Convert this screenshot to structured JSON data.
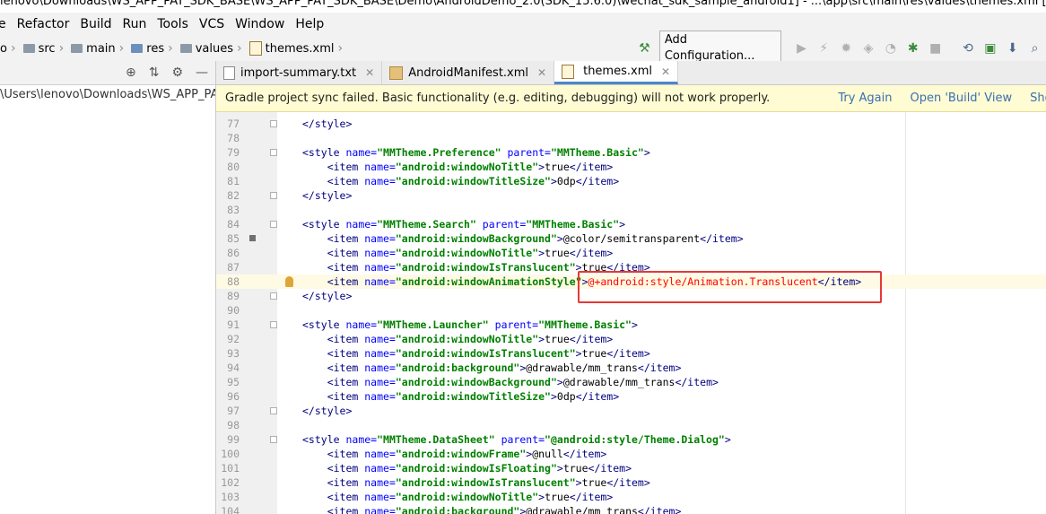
{
  "window": {
    "title": "lenovo\\Downloads\\WS_APP_PAY_SDK_BASE\\WS_APP_PAY_SDK_BASE\\Demo\\AndroidDemo_2.0(SDK_15.6.0)\\wechat_sdk_sample_android1] - ...\\app\\src\\main\\res\\values\\themes.xml [app] -..."
  },
  "menu": {
    "items": [
      "e",
      "Refactor",
      "Build",
      "Run",
      "Tools",
      "VCS",
      "Window",
      "Help"
    ]
  },
  "breadcrumb": {
    "items": [
      "o",
      "src",
      "main",
      "res",
      "values",
      "themes.xml"
    ]
  },
  "toolbar": {
    "add_configuration": "Add Configuration..."
  },
  "sidebar": {
    "path": "\\Users\\lenovo\\Downloads\\WS_APP_PAY_S"
  },
  "tabs": [
    {
      "label": "import-summary.txt",
      "active": false
    },
    {
      "label": "AndroidManifest.xml",
      "active": false
    },
    {
      "label": "themes.xml",
      "active": true
    }
  ],
  "banner": {
    "message": "Gradle project sync failed. Basic functionality (e.g. editing, debugging) will not work properly.",
    "try_again": "Try Again",
    "open_build_view": "Open 'Build' View",
    "show_log": "Show Log in Expl"
  },
  "editor": {
    "lines": [
      {
        "n": "77",
        "code": [
          {
            "t": "tag",
            "s": "</style>"
          }
        ]
      },
      {
        "n": "78",
        "code": []
      },
      {
        "n": "79",
        "code": [
          {
            "t": "tag",
            "s": "<style "
          },
          {
            "t": "attr",
            "s": "name="
          },
          {
            "t": "val",
            "s": "\"MMTheme.Preference\""
          },
          {
            "t": "attr",
            "s": " parent="
          },
          {
            "t": "val",
            "s": "\"MMTheme.Basic\""
          },
          {
            "t": "tag",
            "s": ">"
          }
        ]
      },
      {
        "n": "80",
        "code": [
          {
            "t": "plain",
            "s": "    "
          },
          {
            "t": "tag",
            "s": "<item "
          },
          {
            "t": "attr",
            "s": "name="
          },
          {
            "t": "val",
            "s": "\"android:windowNoTitle\""
          },
          {
            "t": "tag",
            "s": ">"
          },
          {
            "t": "plain",
            "s": "true"
          },
          {
            "t": "tag",
            "s": "</item>"
          }
        ]
      },
      {
        "n": "81",
        "code": [
          {
            "t": "plain",
            "s": "    "
          },
          {
            "t": "tag",
            "s": "<item "
          },
          {
            "t": "attr",
            "s": "name="
          },
          {
            "t": "val",
            "s": "\"android:windowTitleSize\""
          },
          {
            "t": "tag",
            "s": ">"
          },
          {
            "t": "plain",
            "s": "0dp"
          },
          {
            "t": "tag",
            "s": "</item>"
          }
        ]
      },
      {
        "n": "82",
        "code": [
          {
            "t": "tag",
            "s": "</style>"
          }
        ]
      },
      {
        "n": "83",
        "code": []
      },
      {
        "n": "84",
        "code": [
          {
            "t": "tag",
            "s": "<style "
          },
          {
            "t": "attr",
            "s": "name="
          },
          {
            "t": "val",
            "s": "\"MMTheme.Search\""
          },
          {
            "t": "attr",
            "s": " parent="
          },
          {
            "t": "val",
            "s": "\"MMTheme.Basic\""
          },
          {
            "t": "tag",
            "s": ">"
          }
        ]
      },
      {
        "n": "85",
        "code": [
          {
            "t": "plain",
            "s": "    "
          },
          {
            "t": "tag",
            "s": "<item "
          },
          {
            "t": "attr",
            "s": "name="
          },
          {
            "t": "val",
            "s": "\"android:windowBackground\""
          },
          {
            "t": "tag",
            "s": ">"
          },
          {
            "t": "plain",
            "s": "@color/semitransparent"
          },
          {
            "t": "tag",
            "s": "</item>"
          }
        ]
      },
      {
        "n": "86",
        "code": [
          {
            "t": "plain",
            "s": "    "
          },
          {
            "t": "tag",
            "s": "<item "
          },
          {
            "t": "attr",
            "s": "name="
          },
          {
            "t": "val",
            "s": "\"android:windowNoTitle\""
          },
          {
            "t": "tag",
            "s": ">"
          },
          {
            "t": "plain",
            "s": "true"
          },
          {
            "t": "tag",
            "s": "</item>"
          }
        ]
      },
      {
        "n": "87",
        "code": [
          {
            "t": "plain",
            "s": "    "
          },
          {
            "t": "tag",
            "s": "<item "
          },
          {
            "t": "attr",
            "s": "name="
          },
          {
            "t": "val",
            "s": "\"android:windowIsTranslucent\""
          },
          {
            "t": "tag",
            "s": ">"
          },
          {
            "t": "plain",
            "s": "true"
          },
          {
            "t": "tag",
            "s": "</item>"
          }
        ]
      },
      {
        "n": "88",
        "code": [
          {
            "t": "plain",
            "s": "    "
          },
          {
            "t": "tag",
            "s": "<item "
          },
          {
            "t": "attr",
            "s": "name="
          },
          {
            "t": "val",
            "s": "\"android:windowAnimationStyle\""
          },
          {
            "t": "tag",
            "s": ">"
          },
          {
            "t": "red",
            "s": "@+android:style/Animation.Translucent"
          },
          {
            "t": "tag",
            "s": "</item>"
          }
        ]
      },
      {
        "n": "89",
        "code": [
          {
            "t": "tag",
            "s": "</style>"
          }
        ]
      },
      {
        "n": "90",
        "code": []
      },
      {
        "n": "91",
        "code": [
          {
            "t": "tag",
            "s": "<style "
          },
          {
            "t": "attr",
            "s": "name="
          },
          {
            "t": "val",
            "s": "\"MMTheme.Launcher\""
          },
          {
            "t": "attr",
            "s": " parent="
          },
          {
            "t": "val",
            "s": "\"MMTheme.Basic\""
          },
          {
            "t": "tag",
            "s": ">"
          }
        ]
      },
      {
        "n": "92",
        "code": [
          {
            "t": "plain",
            "s": "    "
          },
          {
            "t": "tag",
            "s": "<item "
          },
          {
            "t": "attr",
            "s": "name="
          },
          {
            "t": "val",
            "s": "\"android:windowNoTitle\""
          },
          {
            "t": "tag",
            "s": ">"
          },
          {
            "t": "plain",
            "s": "true"
          },
          {
            "t": "tag",
            "s": "</item>"
          }
        ]
      },
      {
        "n": "93",
        "code": [
          {
            "t": "plain",
            "s": "    "
          },
          {
            "t": "tag",
            "s": "<item "
          },
          {
            "t": "attr",
            "s": "name="
          },
          {
            "t": "val",
            "s": "\"android:windowIsTranslucent\""
          },
          {
            "t": "tag",
            "s": ">"
          },
          {
            "t": "plain",
            "s": "true"
          },
          {
            "t": "tag",
            "s": "</item>"
          }
        ]
      },
      {
        "n": "94",
        "code": [
          {
            "t": "plain",
            "s": "    "
          },
          {
            "t": "tag",
            "s": "<item "
          },
          {
            "t": "attr",
            "s": "name="
          },
          {
            "t": "val",
            "s": "\"android:background\""
          },
          {
            "t": "tag",
            "s": ">"
          },
          {
            "t": "plain",
            "s": "@drawable/mm_trans"
          },
          {
            "t": "tag",
            "s": "</item>"
          }
        ]
      },
      {
        "n": "95",
        "code": [
          {
            "t": "plain",
            "s": "    "
          },
          {
            "t": "tag",
            "s": "<item "
          },
          {
            "t": "attr",
            "s": "name="
          },
          {
            "t": "val",
            "s": "\"android:windowBackground\""
          },
          {
            "t": "tag",
            "s": ">"
          },
          {
            "t": "plain",
            "s": "@drawable/mm_trans"
          },
          {
            "t": "tag",
            "s": "</item>"
          }
        ]
      },
      {
        "n": "96",
        "code": [
          {
            "t": "plain",
            "s": "    "
          },
          {
            "t": "tag",
            "s": "<item "
          },
          {
            "t": "attr",
            "s": "name="
          },
          {
            "t": "val",
            "s": "\"android:windowTitleSize\""
          },
          {
            "t": "tag",
            "s": ">"
          },
          {
            "t": "plain",
            "s": "0dp"
          },
          {
            "t": "tag",
            "s": "</item>"
          }
        ]
      },
      {
        "n": "97",
        "code": [
          {
            "t": "tag",
            "s": "</style>"
          }
        ]
      },
      {
        "n": "98",
        "code": []
      },
      {
        "n": "99",
        "code": [
          {
            "t": "tag",
            "s": "<style "
          },
          {
            "t": "attr",
            "s": "name="
          },
          {
            "t": "val",
            "s": "\"MMTheme.DataSheet\""
          },
          {
            "t": "attr",
            "s": " parent="
          },
          {
            "t": "val",
            "s": "\"@android:style/Theme.Dialog\""
          },
          {
            "t": "tag",
            "s": ">"
          }
        ]
      },
      {
        "n": "100",
        "code": [
          {
            "t": "plain",
            "s": "    "
          },
          {
            "t": "tag",
            "s": "<item "
          },
          {
            "t": "attr",
            "s": "name="
          },
          {
            "t": "val",
            "s": "\"android:windowFrame\""
          },
          {
            "t": "tag",
            "s": ">"
          },
          {
            "t": "plain",
            "s": "@null"
          },
          {
            "t": "tag",
            "s": "</item>"
          }
        ]
      },
      {
        "n": "101",
        "code": [
          {
            "t": "plain",
            "s": "    "
          },
          {
            "t": "tag",
            "s": "<item "
          },
          {
            "t": "attr",
            "s": "name="
          },
          {
            "t": "val",
            "s": "\"android:windowIsFloating\""
          },
          {
            "t": "tag",
            "s": ">"
          },
          {
            "t": "plain",
            "s": "true"
          },
          {
            "t": "tag",
            "s": "</item>"
          }
        ]
      },
      {
        "n": "102",
        "code": [
          {
            "t": "plain",
            "s": "    "
          },
          {
            "t": "tag",
            "s": "<item "
          },
          {
            "t": "attr",
            "s": "name="
          },
          {
            "t": "val",
            "s": "\"android:windowIsTranslucent\""
          },
          {
            "t": "tag",
            "s": ">"
          },
          {
            "t": "plain",
            "s": "true"
          },
          {
            "t": "tag",
            "s": "</item>"
          }
        ]
      },
      {
        "n": "103",
        "code": [
          {
            "t": "plain",
            "s": "    "
          },
          {
            "t": "tag",
            "s": "<item "
          },
          {
            "t": "attr",
            "s": "name="
          },
          {
            "t": "val",
            "s": "\"android:windowNoTitle\""
          },
          {
            "t": "tag",
            "s": ">"
          },
          {
            "t": "plain",
            "s": "true"
          },
          {
            "t": "tag",
            "s": "</item>"
          }
        ]
      },
      {
        "n": "104",
        "code": [
          {
            "t": "plain",
            "s": "    "
          },
          {
            "t": "tag",
            "s": "<item "
          },
          {
            "t": "attr",
            "s": "name="
          },
          {
            "t": "val",
            "s": "\"android:background\""
          },
          {
            "t": "tag",
            "s": ">"
          },
          {
            "t": "plain",
            "s": "@drawable/mm_trans"
          },
          {
            "t": "tag",
            "s": "</item>"
          }
        ]
      }
    ]
  },
  "colors": {
    "accent": "#4a88c7",
    "error_highlight": "#e53935",
    "banner_bg": "#fffbd2",
    "link": "#3a6fb5"
  }
}
